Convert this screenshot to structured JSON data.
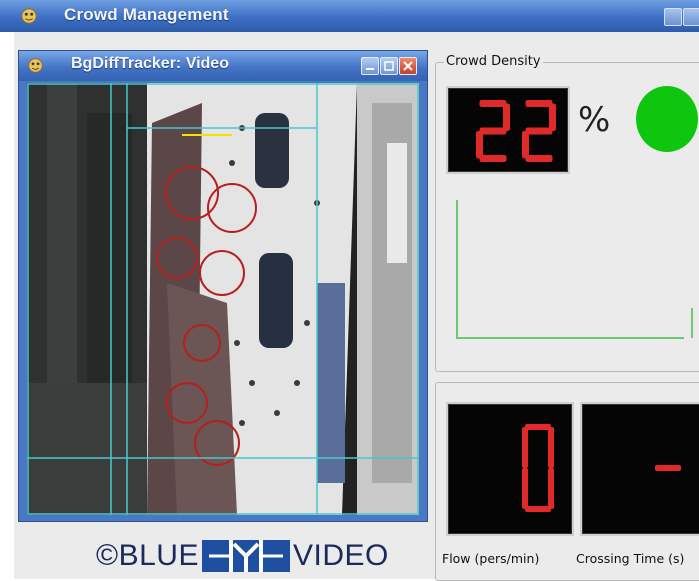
{
  "window": {
    "title": "Crowd Management",
    "status_light_color": "#0ec60e",
    "digit_color": "#e02a2a"
  },
  "video_window": {
    "title": "BgDiffTracker: Video"
  },
  "logo": {
    "prefix": "©BLUE",
    "suffix": "VIDEO"
  },
  "crowd_density": {
    "group_label": "Crowd Density",
    "value": "22",
    "unit": "%"
  },
  "metrics": {
    "flow_value": "0",
    "flow_label": "Flow (pers/min)",
    "crossing_value": "-",
    "crossing_label": "Crossing Time (s)"
  }
}
